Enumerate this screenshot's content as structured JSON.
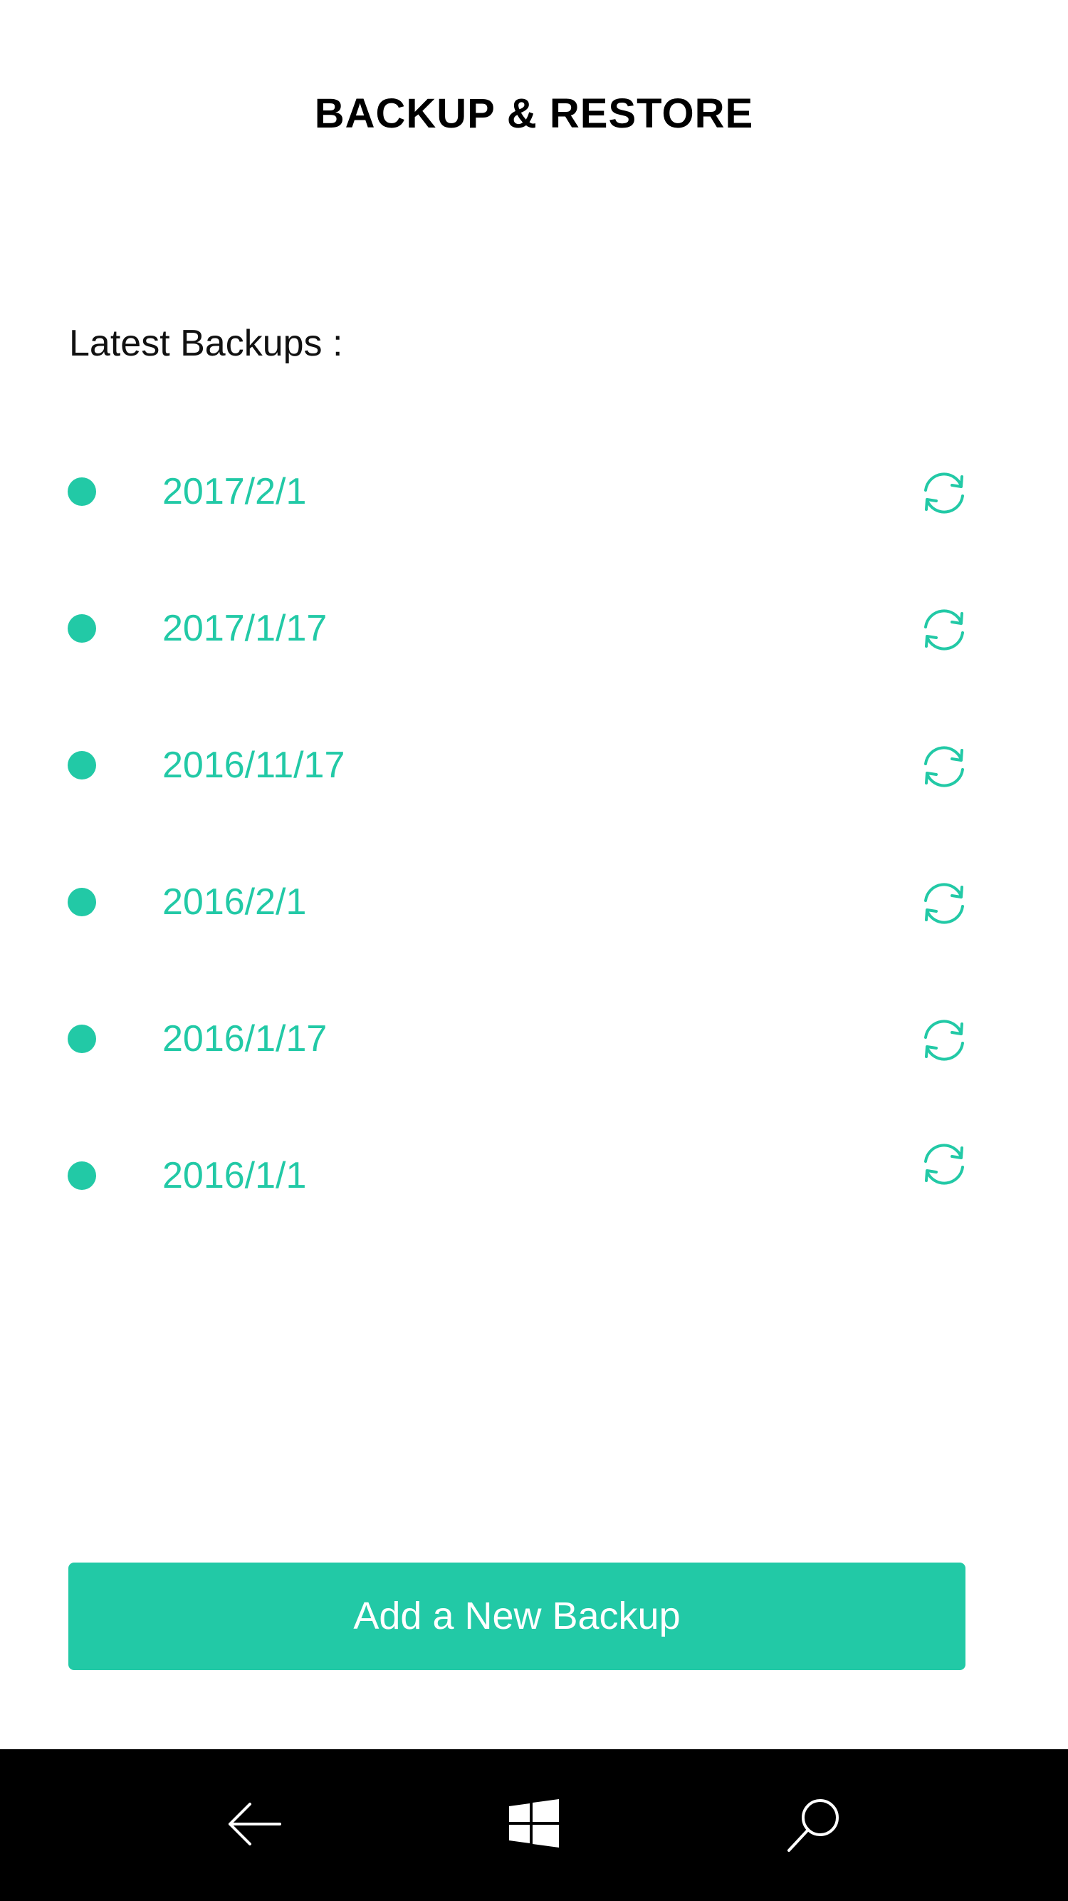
{
  "header": {
    "title": "BACKUP & RESTORE"
  },
  "backups": {
    "label": "Latest Backups :",
    "items": [
      {
        "date": "2017/2/1",
        "action_icon": "sync-icon"
      },
      {
        "date": "2017/1/17",
        "action_icon": "sync-icon"
      },
      {
        "date": "2016/11/17",
        "action_icon": "sync-icon"
      },
      {
        "date": "2016/2/1",
        "action_icon": "sync-icon"
      },
      {
        "date": "2016/1/17",
        "action_icon": "sync-icon"
      },
      {
        "date": "2016/1/1",
        "action_icon": "sync-icon"
      }
    ]
  },
  "actions": {
    "add_backup_label": "Add a New Backup"
  },
  "navbar": {
    "items": [
      {
        "icon": "back-arrow-icon"
      },
      {
        "icon": "windows-logo-icon"
      },
      {
        "icon": "search-icon"
      }
    ]
  },
  "colors": {
    "accent": "#22c9a6",
    "background": "#ffffff",
    "navbar": "#000000",
    "title_text": "#000000"
  }
}
